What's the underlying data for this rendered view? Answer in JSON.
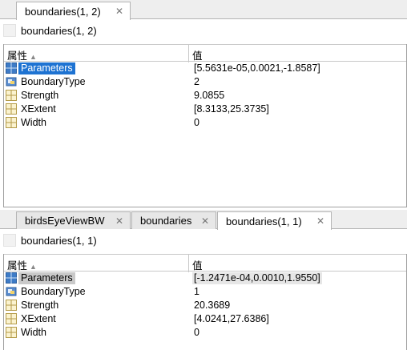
{
  "panel1": {
    "tabs": [
      {
        "label": "boundaries(1, 2)",
        "close": "✕"
      }
    ],
    "header": "boundaries(1, 2)",
    "columns": {
      "property": "属性",
      "value": "值"
    },
    "rows": [
      {
        "name": "Parameters",
        "value": "[5.5631e-05,0.0021,-1.8587]",
        "icon": "matrix-icon"
      },
      {
        "name": "BoundaryType",
        "value": "2",
        "icon": "object-icon"
      },
      {
        "name": "Strength",
        "value": "9.0855",
        "icon": "grid-icon"
      },
      {
        "name": "XExtent",
        "value": "[8.3133,25.3735]",
        "icon": "grid-icon"
      },
      {
        "name": "Width",
        "value": "0",
        "icon": "grid-icon"
      }
    ]
  },
  "panel2": {
    "tabs": [
      {
        "label": "birdsEyeViewBW",
        "close": "✕"
      },
      {
        "label": "boundaries",
        "close": "✕"
      },
      {
        "label": "boundaries(1, 1)",
        "close": "✕"
      }
    ],
    "header": "boundaries(1, 1)",
    "columns": {
      "property": "属性",
      "value": "值"
    },
    "rows": [
      {
        "name": "Parameters",
        "value": "[-1.2471e-04,0.0010,1.9550]",
        "icon": "matrix-icon"
      },
      {
        "name": "BoundaryType",
        "value": "1",
        "icon": "object-icon"
      },
      {
        "name": "Strength",
        "value": "20.3689",
        "icon": "grid-icon"
      },
      {
        "name": "XExtent",
        "value": "[4.0241,27.6386]",
        "icon": "grid-icon"
      },
      {
        "name": "Width",
        "value": "0",
        "icon": "grid-icon"
      }
    ]
  },
  "colors": {
    "selection": "#1e73d2",
    "inactive_selection": "#c9c9c9",
    "tab_bg": "#eeeeee"
  }
}
